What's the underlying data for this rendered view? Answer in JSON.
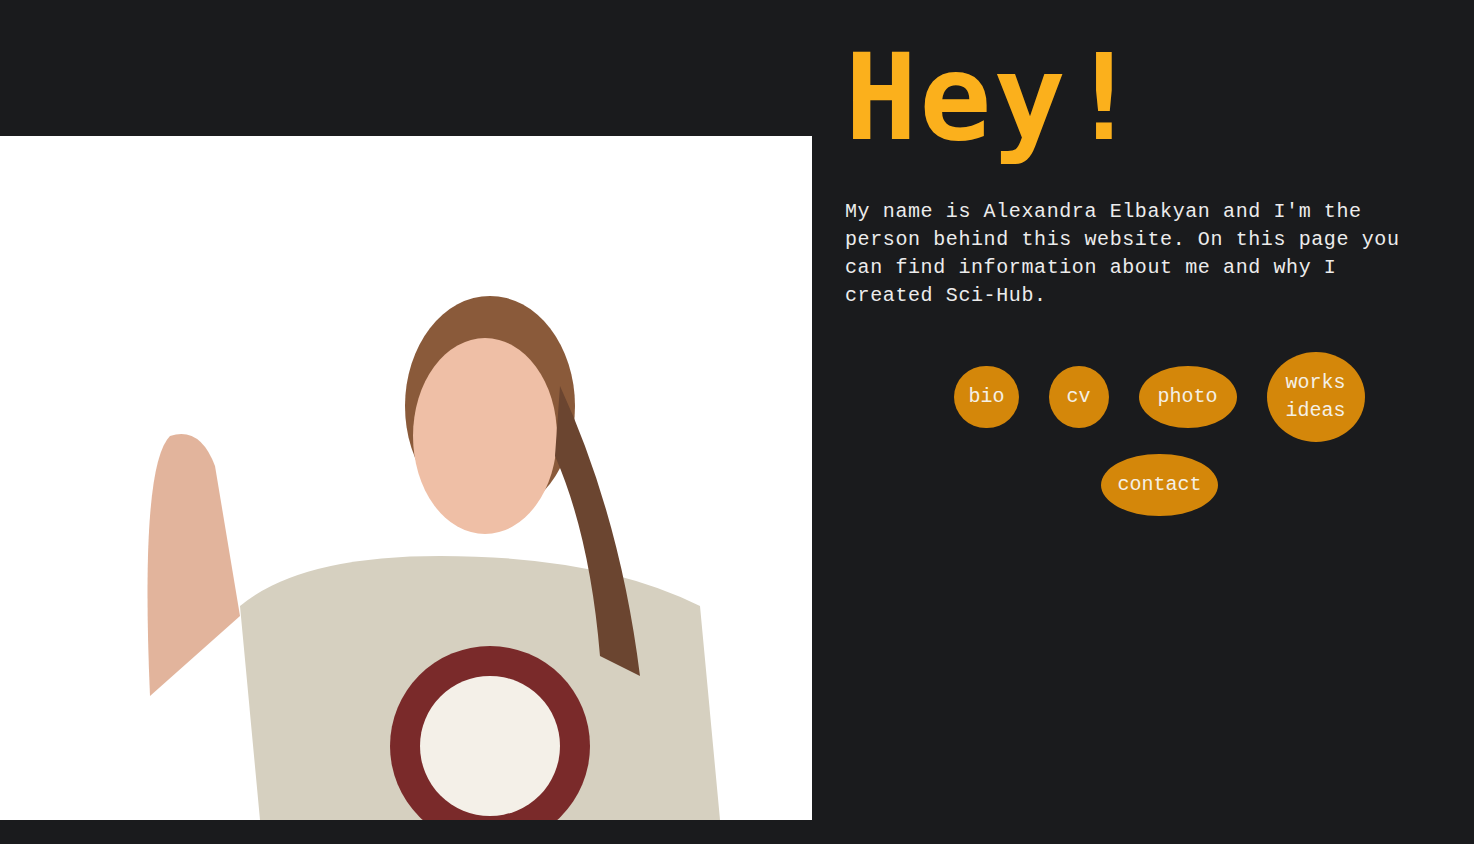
{
  "greeting": "Hey!",
  "intro": "My name is Alexandra Elbakyan and I'm the person behind this website. On this page you can find information about me and why I created Sci-Hub.",
  "nav": [
    {
      "label": "bio",
      "kind": "small"
    },
    {
      "label": "cv",
      "kind": "small"
    },
    {
      "label": "photo",
      "kind": "wide"
    },
    {
      "label": "works ideas",
      "kind": "tall"
    },
    {
      "label": "contact",
      "kind": "wide"
    }
  ]
}
